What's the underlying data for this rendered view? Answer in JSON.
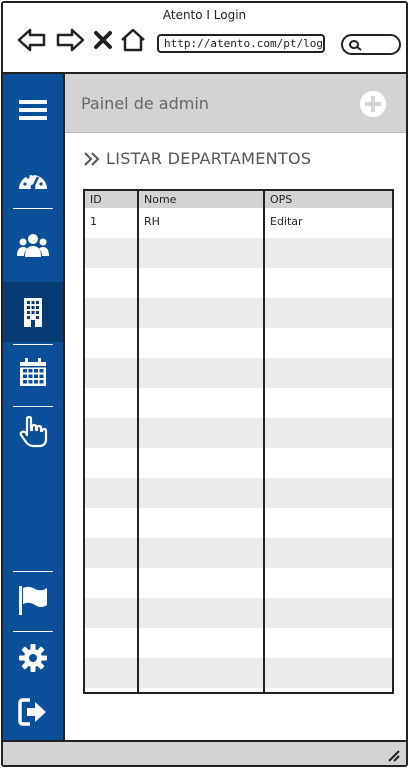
{
  "window": {
    "title": "Atento I Login"
  },
  "browser": {
    "url": "http://atento.com/pt/login/",
    "icons": [
      "back-arrow-icon",
      "forward-arrow-icon",
      "close-x-icon",
      "home-icon",
      "search-icon"
    ]
  },
  "sidebar": {
    "items": [
      {
        "name": "menu",
        "icon": "hamburger-icon"
      },
      {
        "name": "dashboard",
        "icon": "dashboard-gauge-icon"
      },
      {
        "name": "users",
        "icon": "users-group-icon"
      },
      {
        "name": "departments",
        "icon": "building-icon",
        "active": true
      },
      {
        "name": "calendar",
        "icon": "calendar-icon"
      },
      {
        "name": "touch",
        "icon": "hand-pointer-icon"
      },
      {
        "name": "flag",
        "icon": "flag-icon"
      },
      {
        "name": "settings",
        "icon": "gear-icon"
      },
      {
        "name": "logout",
        "icon": "sign-out-icon"
      }
    ],
    "color": "#0b4f9a",
    "active_color": "#063a72"
  },
  "header": {
    "title": "Painel de admin",
    "add_icon": "plus-circle-icon"
  },
  "section": {
    "title": "LISTAR DEPARTAMENTOS",
    "icon": "double-chevron-right-icon"
  },
  "table": {
    "columns": [
      "ID",
      "Nome",
      "OPS"
    ],
    "rows": [
      [
        "1",
        "RH",
        "Editar"
      ]
    ],
    "empty_rows": 15
  }
}
